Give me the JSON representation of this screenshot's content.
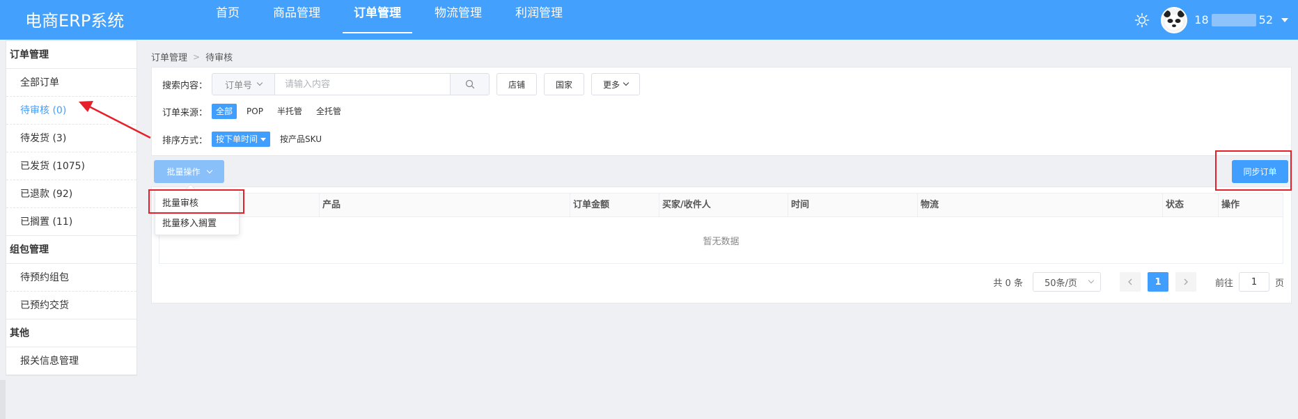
{
  "app": {
    "title": "电商ERP系统"
  },
  "nav": {
    "items": [
      {
        "label": "首页",
        "active": false
      },
      {
        "label": "商品管理",
        "active": false
      },
      {
        "label": "订单管理",
        "active": true
      },
      {
        "label": "物流管理",
        "active": false
      },
      {
        "label": "利润管理",
        "active": false
      }
    ]
  },
  "user": {
    "name_prefix": "18",
    "name_suffix": "52"
  },
  "sidebar": {
    "groups": [
      {
        "title": "订单管理",
        "items": [
          "全部订单",
          "待审核 (0)",
          "待发货 (3)",
          "已发货 (1075)",
          "已退款 (92)",
          "已搁置 (11)"
        ]
      },
      {
        "title": "组包管理",
        "items": [
          "待预约组包",
          "已预约交货"
        ]
      },
      {
        "title": "其他",
        "items": [
          "报关信息管理"
        ]
      }
    ],
    "active_item": "待审核 (0)"
  },
  "breadcrumb": {
    "root": "订单管理",
    "current": "待审核"
  },
  "filters": {
    "search_label": "搜索内容：",
    "search_type": "订单号",
    "search_placeholder": "请输入内容",
    "search_value": "",
    "shop_button": "店铺",
    "country_button": "国家",
    "more_button": "更多",
    "source_label": "订单来源：",
    "source_options": [
      "全部",
      "POP",
      "半托管",
      "全托管"
    ],
    "source_selected": "全部",
    "sort_label": "排序方式：",
    "sort_options": [
      "按下单时间",
      "按产品SKU"
    ],
    "sort_selected": "按下单时间"
  },
  "actions": {
    "batch_label": "批量操作",
    "batch_menu": [
      "批量审核",
      "批量移入搁置"
    ],
    "sync_label": "同步订单"
  },
  "table": {
    "columns": [
      "产品",
      "订单金额",
      "买家/收件人",
      "时间",
      "物流",
      "状态",
      "操作"
    ],
    "empty_text": "暂无数据"
  },
  "pagination": {
    "total_text": "共 0 条",
    "page_size": "50条/页",
    "current_page": "1",
    "goto_label": "前往",
    "goto_value": "1",
    "page_unit": "页"
  },
  "colors": {
    "primary": "#409eff",
    "topbar": "#43a0fc",
    "annotation": "#e6202a"
  }
}
